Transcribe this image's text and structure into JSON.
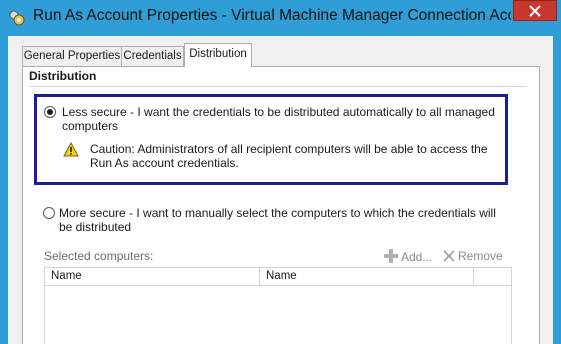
{
  "window": {
    "title": "Run As Account Properties - Virtual Machine Manager Connection Accou..."
  },
  "tabs": [
    {
      "label": "General Properties"
    },
    {
      "label": "Credentials"
    },
    {
      "label": "Distribution",
      "active": true
    }
  ],
  "distribution": {
    "heading": "Distribution",
    "options": [
      {
        "label": "Less secure - I want the credentials to be distributed automatically to all managed computers",
        "selected": true
      },
      {
        "label": "More secure - I want to manually select the computers to which the credentials will be distributed",
        "selected": false
      }
    ],
    "caution": "Caution: Administrators of all recipient computers will be able to access the Run As account credentials.",
    "selected_computers_label": "Selected computers:",
    "add_label": "Add...",
    "remove_label": "Remove",
    "columns": [
      "Name",
      "Name"
    ]
  },
  "icons": {
    "app": "run-as-account-icon",
    "close": "close-icon",
    "warning": "warning-icon",
    "add": "plus-icon",
    "remove": "x-icon"
  },
  "colors": {
    "title_bar": "#2f9ed6",
    "close_button": "#c7392f",
    "highlight_border": "#1c1c9e",
    "warning_fill": "#f5d21b"
  }
}
